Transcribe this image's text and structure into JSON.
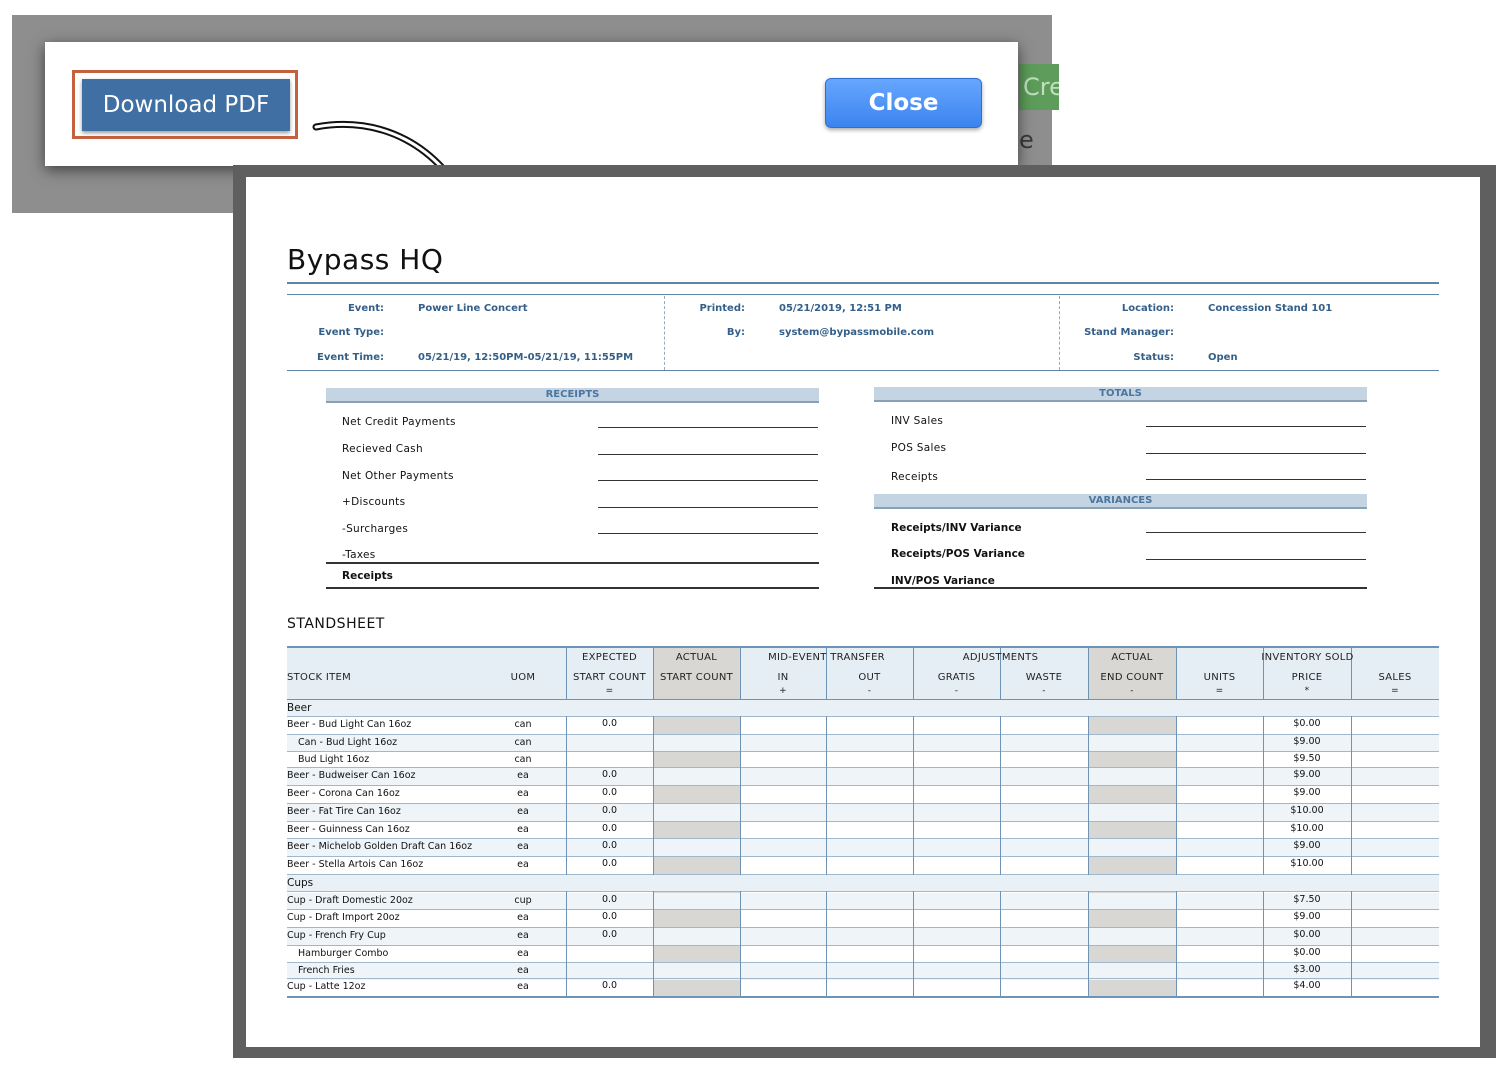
{
  "modal": {
    "download_label": "Download PDF",
    "close_label": "Close",
    "background_button_partial": "Cre",
    "background_text_partial": "e Co"
  },
  "document": {
    "title": "Bypass HQ",
    "info": {
      "event_label": "Event:",
      "event_value": "Power Line Concert",
      "event_type_label": "Event Type:",
      "event_type_value": "",
      "event_time_label": "Event Time:",
      "event_time_value": "05/21/19, 12:50PM-05/21/19, 11:55PM",
      "printed_label": "Printed:",
      "printed_value": "05/21/2019, 12:51 PM",
      "by_label": "By:",
      "by_value": "system@bypassmobile.com",
      "location_label": "Location:",
      "location_value": "Concession Stand 101",
      "stand_manager_label": "Stand Manager:",
      "stand_manager_value": "",
      "status_label": "Status:",
      "status_value": "Open"
    },
    "receipts": {
      "header": "RECEIPTS",
      "items": [
        "Net Credit Payments",
        "Recieved Cash",
        "Net Other Payments",
        "+Discounts",
        "-Surcharges",
        "-Taxes"
      ],
      "total_label": "Receipts"
    },
    "totals": {
      "header": "TOTALS",
      "items": [
        "INV Sales",
        "POS Sales",
        "Receipts"
      ]
    },
    "variances": {
      "header": "VARIANCES",
      "items": [
        "Receipts/INV Variance",
        "Receipts/POS Variance",
        "INV/POS Variance"
      ]
    },
    "standsheet": {
      "title": "STANDSHEET",
      "headers": {
        "stock_item": "STOCK ITEM",
        "uom": "UOM",
        "expected": "EXPECTED",
        "expected_start": "START COUNT",
        "expected_sym": "=",
        "actual1": "ACTUAL",
        "actual1_start": "START COUNT",
        "transfer": "MID-EVENT TRANSFER",
        "in": "IN",
        "in_sym": "+",
        "out": "OUT",
        "out_sym": "-",
        "adjustments": "ADJUSTMENTS",
        "gratis": "GRATIS",
        "gratis_sym": "-",
        "waste": "WASTE",
        "waste_sym": "-",
        "actual2": "ACTUAL",
        "end_count": "END COUNT",
        "end_sym": "-",
        "inventory_sold": "INVENTORY SOLD",
        "units": "UNITS",
        "units_sym": "=",
        "price": "PRICE",
        "price_sym": "*",
        "sales": "SALES",
        "sales_sym": "="
      },
      "categories": {
        "beer": "Beer",
        "cups": "Cups"
      },
      "rows": [
        {
          "item": "Beer - Bud Light Can 16oz",
          "uom": "can",
          "expected": "0.0",
          "price": "$0.00"
        },
        {
          "item": "Can - Bud Light 16oz",
          "uom": "can",
          "expected": "",
          "price": "$9.00"
        },
        {
          "item": "Bud Light 16oz",
          "uom": "can",
          "expected": "",
          "price": "$9.50"
        },
        {
          "item": "Beer - Budweiser Can 16oz",
          "uom": "ea",
          "expected": "0.0",
          "price": "$9.00"
        },
        {
          "item": "Beer - Corona Can 16oz",
          "uom": "ea",
          "expected": "0.0",
          "price": "$9.00"
        },
        {
          "item": "Beer - Fat Tire Can 16oz",
          "uom": "ea",
          "expected": "0.0",
          "price": "$10.00"
        },
        {
          "item": "Beer - Guinness Can 16oz",
          "uom": "ea",
          "expected": "0.0",
          "price": "$10.00"
        },
        {
          "item": "Beer - Michelob Golden Draft Can 16oz",
          "uom": "ea",
          "expected": "0.0",
          "price": "$9.00"
        },
        {
          "item": "Beer - Stella Artois Can 16oz",
          "uom": "ea",
          "expected": "0.0",
          "price": "$10.00"
        },
        {
          "item": "Cup - Draft Domestic 20oz",
          "uom": "cup",
          "expected": "0.0",
          "price": "$7.50"
        },
        {
          "item": "Cup - Draft Import 20oz",
          "uom": "ea",
          "expected": "0.0",
          "price": "$9.00"
        },
        {
          "item": "Cup - French Fry Cup",
          "uom": "ea",
          "expected": "0.0",
          "price": "$0.00"
        },
        {
          "item": "Hamburger Combo",
          "uom": "ea",
          "expected": "",
          "price": "$0.00"
        },
        {
          "item": "French Fries",
          "uom": "ea",
          "expected": "",
          "price": "$3.00"
        },
        {
          "item": "Cup - Latte 12oz",
          "uom": "ea",
          "expected": "0.0",
          "price": "$4.00"
        }
      ]
    }
  }
}
